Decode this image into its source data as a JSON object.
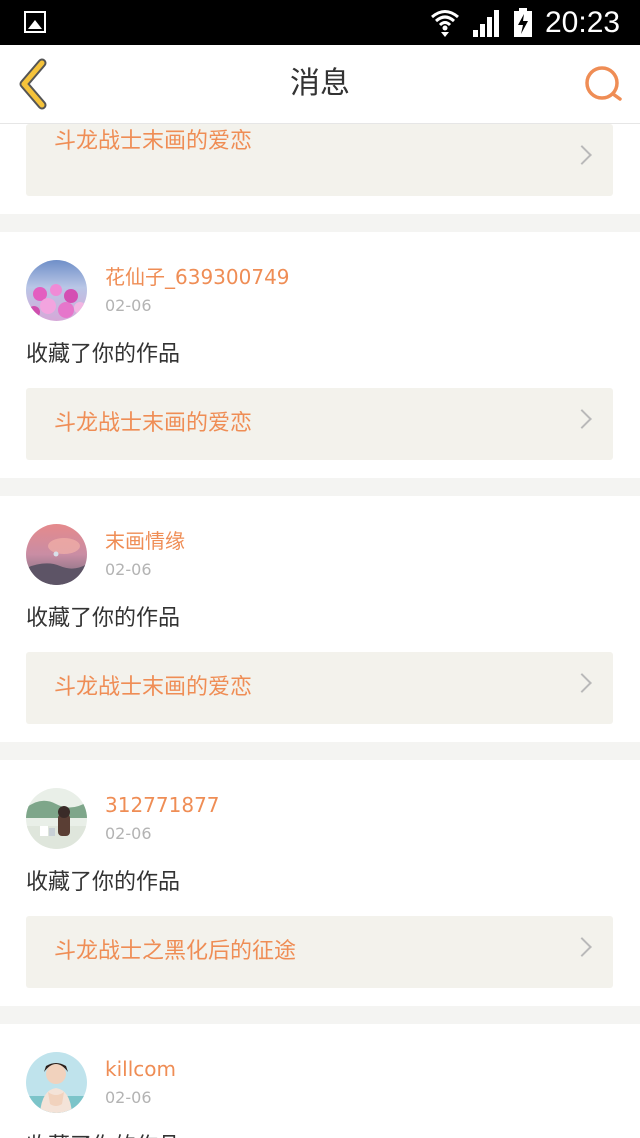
{
  "status_bar": {
    "time": "20:23"
  },
  "header": {
    "title": "消息"
  },
  "top_card": {
    "work_title": "斗龙战士末画的爱恋"
  },
  "messages": [
    {
      "username": "花仙子_639300749",
      "date": "02-06",
      "action": "收藏了你的作品",
      "work_title": "斗龙战士末画的爱恋",
      "avatar": "pink-flowers"
    },
    {
      "username": "末画情缘",
      "date": "02-06",
      "action": "收藏了你的作品",
      "work_title": "斗龙战士末画的爱恋",
      "avatar": "pink-sky"
    },
    {
      "username": "312771877",
      "date": "02-06",
      "action": "收藏了你的作品",
      "work_title": "斗龙战士之黑化后的征途",
      "avatar": "anime-figures"
    },
    {
      "username": "killcom",
      "date": "02-06",
      "action": "收藏了你的作品",
      "avatar": "girl-portrait"
    }
  ],
  "colors": {
    "accent": "#ef8d55",
    "back_arrow": "#f5c33b",
    "link_background": "#f3f2ec",
    "page_background": "#f4f4f2"
  }
}
